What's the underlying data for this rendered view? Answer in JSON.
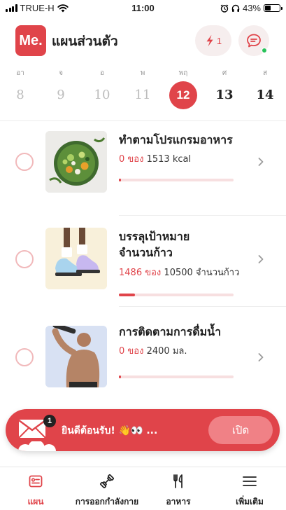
{
  "status_bar": {
    "carrier": "TRUE-H",
    "time": "11:00",
    "battery_percent": "43%",
    "battery_level": 0.43
  },
  "header": {
    "logo_text": "Me.",
    "title": "แผนส่วนตัว",
    "streak_count": "1",
    "chat_has_notification": true
  },
  "week": {
    "selected_index": 4,
    "days": [
      {
        "label": "อา",
        "date": "8",
        "state": "past"
      },
      {
        "label": "จ",
        "date": "9",
        "state": "past"
      },
      {
        "label": "อ",
        "date": "10",
        "state": "past"
      },
      {
        "label": "พ",
        "date": "11",
        "state": "past"
      },
      {
        "label": "พฤ",
        "date": "12",
        "state": "today"
      },
      {
        "label": "ศ",
        "date": "13",
        "state": "future"
      },
      {
        "label": "ส",
        "date": "14",
        "state": "future"
      }
    ]
  },
  "tasks": [
    {
      "title": "ทำตามโปรแกรมอาหาร",
      "current": "0",
      "of_label": "ของ",
      "target": "1513 kcal",
      "progress": 0.02,
      "thumb": "salad-bowl-image"
    },
    {
      "title_line1": "บรรลุเป้าหมาย",
      "title_line2": "จำนวนก้าว",
      "current": "1486",
      "of_label": "ของ",
      "target": "10500 จำนวนก้าว",
      "progress": 0.14,
      "thumb": "sneakers-image"
    },
    {
      "title": "การติดตามการดื่มน้ำ",
      "current": "0",
      "of_label": "ของ",
      "target": "2400 มล.",
      "progress": 0.02,
      "thumb": "man-drinking-image"
    }
  ],
  "banner": {
    "badge_count": "1",
    "message": "ยินดีต้อนรับ! 👋👀 ...",
    "button_label": "เปิด"
  },
  "tabs": [
    {
      "label": "แผน",
      "icon": "plan-icon",
      "active": true
    },
    {
      "label": "การออกกำลังกาย",
      "icon": "dumbbell-icon",
      "active": false
    },
    {
      "label": "อาหาร",
      "icon": "utensils-icon",
      "active": false
    },
    {
      "label": "เพิ่มเติม",
      "icon": "menu-icon",
      "active": false
    }
  ],
  "colors": {
    "accent": "#e0444a",
    "track": "#f7dfe0",
    "online": "#28c25a"
  }
}
